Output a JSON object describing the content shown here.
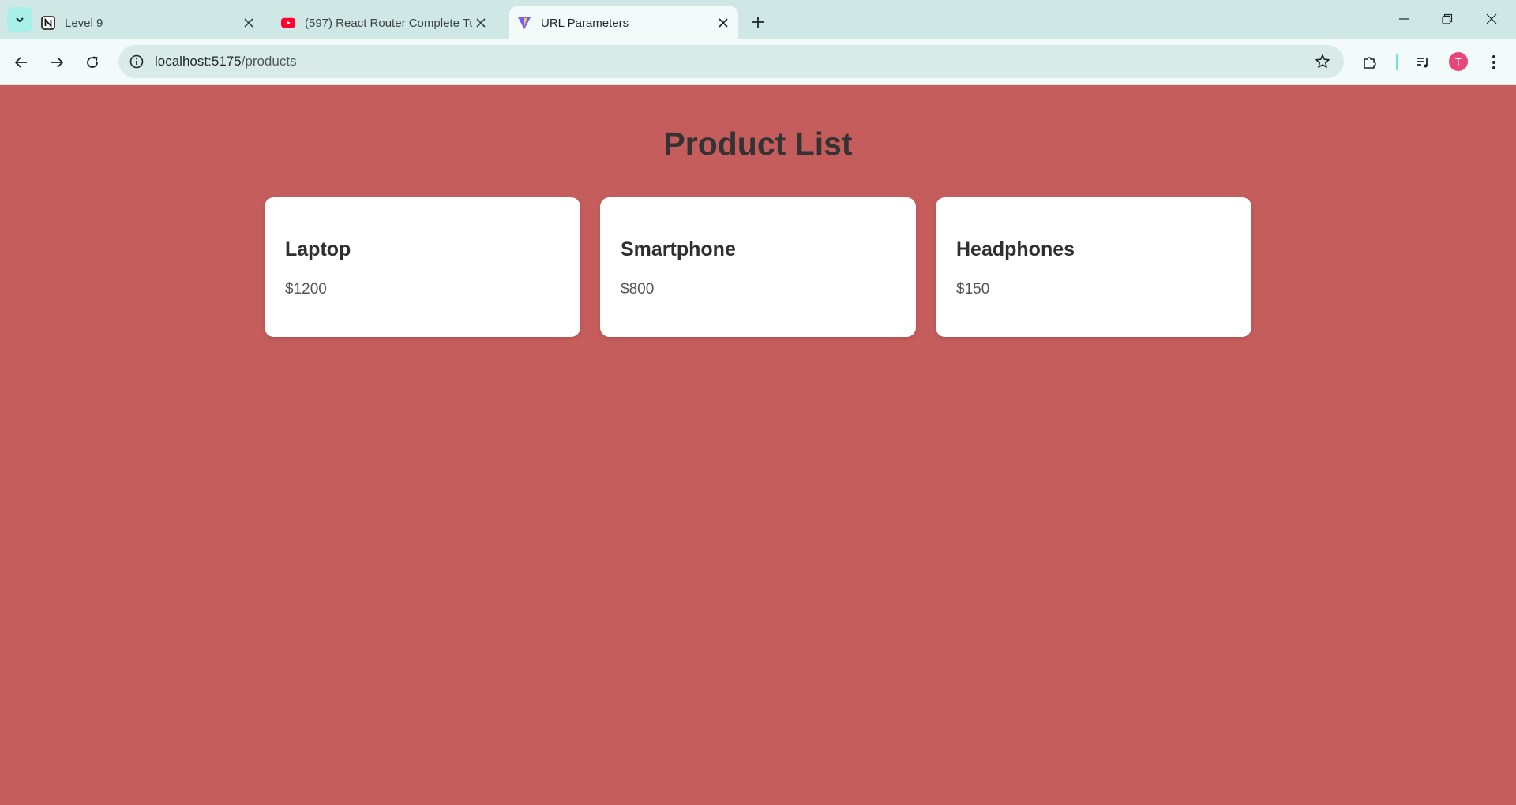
{
  "browser": {
    "tabs": [
      {
        "title": "Level 9",
        "icon": "notion-icon"
      },
      {
        "title": "(597) React Router Complete Tu",
        "icon": "youtube-icon"
      },
      {
        "title": "URL Parameters",
        "icon": "vite-icon",
        "active": true
      }
    ],
    "address": {
      "host": "localhost:5175",
      "path": "/products"
    },
    "profile_initial": "T"
  },
  "page": {
    "title": "Product List",
    "products": [
      {
        "name": "Laptop",
        "price": "$1200"
      },
      {
        "name": "Smartphone",
        "price": "$800"
      },
      {
        "name": "Headphones",
        "price": "$150"
      }
    ]
  },
  "colors": {
    "page_background": "#c65d5d",
    "card_background": "#ffffff",
    "tabstrip": "#cfe8e6",
    "toolbar": "#f3fbfa",
    "avatar": "#e8457a"
  }
}
